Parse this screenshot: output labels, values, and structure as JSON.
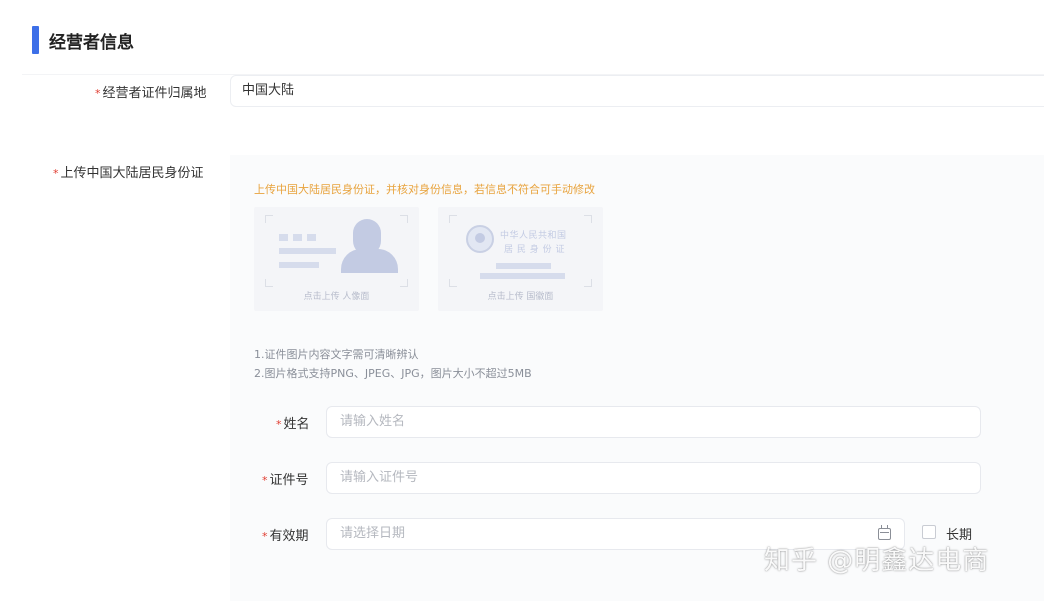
{
  "section": {
    "title": "经营者信息"
  },
  "region": {
    "label": "经营者证件归属地",
    "value": "中国大陆"
  },
  "upload": {
    "label": "上传中国大陆居民身份证",
    "hint": "上传中国大陆居民身份证，并核对身份信息，若信息不符合可手动修改",
    "front_caption": "点击上传 人像面",
    "back_caption": "点击上传 国徽面",
    "back_line1": "中华人民共和国",
    "back_line2": "居 民 身 份 证",
    "notes": [
      "1.证件图片内容文字需可清晰辨认",
      "2.图片格式支持PNG、JPEG、JPG，图片大小不超过5MB"
    ]
  },
  "name": {
    "label": "姓名",
    "placeholder": "请输入姓名"
  },
  "id_number": {
    "label": "证件号",
    "placeholder": "请输入证件号"
  },
  "validity": {
    "label": "有效期",
    "placeholder": "请选择日期",
    "long_term_label": "长期"
  },
  "required_mark": "*",
  "watermark": "知乎 @明鑫达电商",
  "colors": {
    "accent": "#3d6fe8",
    "required": "#e03b2f",
    "hint": "#e8a33d"
  }
}
